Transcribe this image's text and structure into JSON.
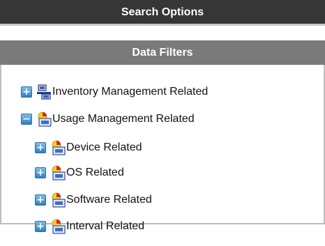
{
  "header": {
    "title": "Search Options"
  },
  "filters": {
    "title": "Data Filters",
    "tree": [
      {
        "label": "Inventory Management Related",
        "state": "collapsed",
        "icon": "network-computers-icon"
      },
      {
        "label": "Usage Management Related",
        "state": "expanded",
        "icon": "usage-folder-icon",
        "children": [
          {
            "label": "Device Related",
            "state": "collapsed",
            "icon": "usage-folder-icon"
          },
          {
            "label": "OS Related",
            "state": "collapsed",
            "icon": "usage-folder-icon"
          },
          {
            "label": "Software Related",
            "state": "collapsed",
            "icon": "usage-folder-icon"
          },
          {
            "label": "Interval Related",
            "state": "collapsed",
            "icon": "usage-folder-icon"
          }
        ]
      }
    ],
    "toggle_symbols": {
      "collapsed": "+",
      "expanded": "−"
    }
  },
  "colors": {
    "header_bg": "#363636",
    "filters_bg": "#7a7a7a",
    "toggle": "#2f7fbf"
  }
}
